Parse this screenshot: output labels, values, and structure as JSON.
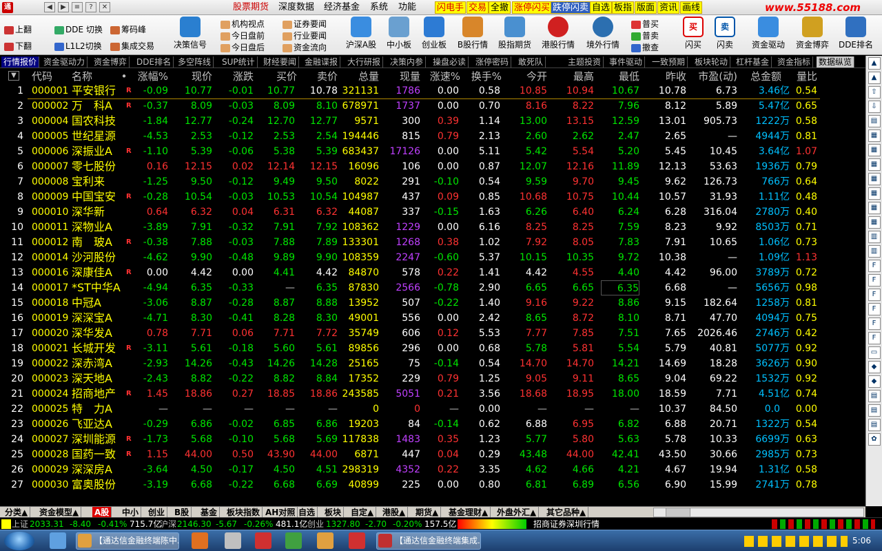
{
  "menubar": {
    "items": [
      "股票期货",
      "深度数据",
      "经济基金",
      "系统",
      "功能"
    ],
    "highlight": [
      "闪电手",
      "交易",
      "全撤",
      "涨停闪买",
      "跌停闪卖",
      "自选",
      "板指",
      "版面",
      "资讯",
      "画线"
    ],
    "url": "www.55188.com"
  },
  "toolbar": {
    "page_up": "上翻",
    "page_down": "下翻",
    "dde_switch": "DDE 切换",
    "l1l2_switch": "L1L2切换",
    "chip_peak": "筹码峰",
    "group_trade": "集成交易",
    "decision_signal": "决策信号",
    "views": [
      "机构视点",
      "今日盘前",
      "今日盘后"
    ],
    "news": [
      "证券要闻",
      "行业要闻",
      "资金流向"
    ],
    "market_buttons": [
      "沪深A股",
      "中小板",
      "创业板",
      "B股行情",
      "股指期货",
      "港股行情",
      "境外行情"
    ],
    "orders": [
      "普买",
      "普卖",
      "撤查"
    ],
    "flash_buy": "闪买",
    "flash_sell": "闪卖",
    "right_buttons": [
      "资金驱动",
      "资金博弈",
      "DDE排名"
    ]
  },
  "tabs": [
    "行情报价",
    "资金驱动力",
    "资金博弈",
    "DDE排名",
    "多空阵线",
    "SUP统计",
    "财经要闻",
    "金融谍报",
    "大行研报",
    "决策内参",
    "操盘必读",
    "涨停密码",
    "敢死队",
    "主题投资",
    "事件驱动",
    "一致预期",
    "板块轮动",
    "杠杆基金",
    "资金指标",
    "数据纵览"
  ],
  "columns": [
    "代码",
    "名称",
    "•",
    "涨幅%",
    "现价",
    "涨跌",
    "买价",
    "卖价",
    "总量",
    "现量",
    "涨速%",
    "换手%",
    "今开",
    "最高",
    "最低",
    "昨收",
    "市盈(动)",
    "总金额",
    "量比"
  ],
  "rows": [
    {
      "n": "1",
      "code": "000001",
      "name": "平安银行",
      "r": "R",
      "chg": "-0.09",
      "price": "10.77",
      "diff": "-0.01",
      "bid": "10.77",
      "ask": "10.78",
      "vol": "321131",
      "cur": "1786",
      "spd": "0.00",
      "turn": "0.58",
      "open": "10.85",
      "high": "10.94",
      "low": "10.67",
      "prev": "10.78",
      "pe": "6.73",
      "amt": "3.46",
      "amtu": "亿",
      "ratio": "0.54"
    },
    {
      "n": "2",
      "code": "000002",
      "name": "万　科A",
      "r": "R",
      "chg": "-0.37",
      "price": "8.09",
      "diff": "-0.03",
      "bid": "8.09",
      "ask": "8.10",
      "vol": "678971",
      "cur": "1737",
      "spd": "0.00",
      "turn": "0.70",
      "open": "8.16",
      "high": "8.22",
      "low": "7.96",
      "prev": "8.12",
      "pe": "5.89",
      "amt": "5.47",
      "amtu": "亿",
      "ratio": "0.65"
    },
    {
      "n": "3",
      "code": "000004",
      "name": "国农科技",
      "r": "",
      "chg": "-1.84",
      "price": "12.77",
      "diff": "-0.24",
      "bid": "12.70",
      "ask": "12.77",
      "vol": "9571",
      "cur": "300",
      "spd": "0.39",
      "turn": "1.14",
      "open": "13.00",
      "high": "13.15",
      "low": "12.59",
      "prev": "13.01",
      "pe": "905.73",
      "amt": "1222",
      "amtu": "万",
      "ratio": "0.58"
    },
    {
      "n": "4",
      "code": "000005",
      "name": "世纪星源",
      "r": "",
      "chg": "-4.53",
      "price": "2.53",
      "diff": "-0.12",
      "bid": "2.53",
      "ask": "2.54",
      "vol": "194446",
      "cur": "815",
      "spd": "0.79",
      "turn": "2.13",
      "open": "2.60",
      "high": "2.62",
      "low": "2.47",
      "prev": "2.65",
      "pe": "—",
      "amt": "4944",
      "amtu": "万",
      "ratio": "0.81"
    },
    {
      "n": "5",
      "code": "000006",
      "name": "深振业A",
      "r": "R",
      "chg": "-1.10",
      "price": "5.39",
      "diff": "-0.06",
      "bid": "5.38",
      "ask": "5.39",
      "vol": "683437",
      "cur": "17126",
      "spd": "0.00",
      "turn": "5.11",
      "open": "5.42",
      "high": "5.54",
      "low": "5.20",
      "prev": "5.45",
      "pe": "10.45",
      "amt": "3.64",
      "amtu": "亿",
      "ratio": "1.07"
    },
    {
      "n": "6",
      "code": "000007",
      "name": "零七股份",
      "r": "",
      "chg": "0.16",
      "price": "12.15",
      "diff": "0.02",
      "bid": "12.14",
      "ask": "12.15",
      "vol": "16096",
      "cur": "106",
      "spd": "0.00",
      "turn": "0.87",
      "open": "12.07",
      "high": "12.16",
      "low": "11.89",
      "prev": "12.13",
      "pe": "53.63",
      "amt": "1936",
      "amtu": "万",
      "ratio": "0.79"
    },
    {
      "n": "7",
      "code": "000008",
      "name": "宝利来",
      "r": "",
      "chg": "-1.25",
      "price": "9.50",
      "diff": "-0.12",
      "bid": "9.49",
      "ask": "9.50",
      "vol": "8022",
      "cur": "291",
      "spd": "-0.10",
      "turn": "0.54",
      "open": "9.59",
      "high": "9.70",
      "low": "9.45",
      "prev": "9.62",
      "pe": "126.73",
      "amt": "766",
      "amtu": "万",
      "ratio": "0.64"
    },
    {
      "n": "8",
      "code": "000009",
      "name": "中国宝安",
      "r": "R",
      "chg": "-0.28",
      "price": "10.54",
      "diff": "-0.03",
      "bid": "10.53",
      "ask": "10.54",
      "vol": "104987",
      "cur": "437",
      "spd": "0.09",
      "turn": "0.85",
      "open": "10.68",
      "high": "10.75",
      "low": "10.44",
      "prev": "10.57",
      "pe": "31.93",
      "amt": "1.11",
      "amtu": "亿",
      "ratio": "0.48"
    },
    {
      "n": "9",
      "code": "000010",
      "name": "深华新",
      "r": "",
      "chg": "0.64",
      "price": "6.32",
      "diff": "0.04",
      "bid": "6.31",
      "ask": "6.32",
      "vol": "44087",
      "cur": "337",
      "spd": "-0.15",
      "turn": "1.63",
      "open": "6.26",
      "high": "6.40",
      "low": "6.24",
      "prev": "6.28",
      "pe": "316.04",
      "amt": "2780",
      "amtu": "万",
      "ratio": "0.40"
    },
    {
      "n": "10",
      "code": "000011",
      "name": "深物业A",
      "r": "",
      "chg": "-3.89",
      "price": "7.91",
      "diff": "-0.32",
      "bid": "7.91",
      "ask": "7.92",
      "vol": "108362",
      "cur": "1229",
      "spd": "0.00",
      "turn": "6.16",
      "open": "8.25",
      "high": "8.25",
      "low": "7.59",
      "prev": "8.23",
      "pe": "9.92",
      "amt": "8503",
      "amtu": "万",
      "ratio": "0.71"
    },
    {
      "n": "11",
      "code": "000012",
      "name": "南　玻A",
      "r": "R",
      "chg": "-0.38",
      "price": "7.88",
      "diff": "-0.03",
      "bid": "7.88",
      "ask": "7.89",
      "vol": "133301",
      "cur": "1268",
      "spd": "0.38",
      "turn": "1.02",
      "open": "7.92",
      "high": "8.05",
      "low": "7.83",
      "prev": "7.91",
      "pe": "10.65",
      "amt": "1.06",
      "amtu": "亿",
      "ratio": "0.73"
    },
    {
      "n": "12",
      "code": "000014",
      "name": "沙河股份",
      "r": "",
      "chg": "-4.62",
      "price": "9.90",
      "diff": "-0.48",
      "bid": "9.89",
      "ask": "9.90",
      "vol": "108359",
      "cur": "2247",
      "spd": "-0.60",
      "turn": "5.37",
      "open": "10.15",
      "high": "10.35",
      "low": "9.72",
      "prev": "10.38",
      "pe": "—",
      "amt": "1.09",
      "amtu": "亿",
      "ratio": "1.13"
    },
    {
      "n": "13",
      "code": "000016",
      "name": "深康佳A",
      "r": "R",
      "chg": "0.00",
      "price": "4.42",
      "diff": "0.00",
      "bid": "4.41",
      "ask": "4.42",
      "vol": "84870",
      "cur": "578",
      "spd": "0.22",
      "turn": "1.41",
      "open": "4.42",
      "high": "4.55",
      "low": "4.40",
      "prev": "4.42",
      "pe": "96.00",
      "amt": "3789",
      "amtu": "万",
      "ratio": "0.72"
    },
    {
      "n": "14",
      "code": "000017",
      "name": "*ST中华A",
      "r": "",
      "chg": "-4.94",
      "price": "6.35",
      "diff": "-0.33",
      "bid": "—",
      "ask": "6.35",
      "vol": "87830",
      "cur": "2566",
      "spd": "-0.78",
      "turn": "2.90",
      "open": "6.65",
      "high": "6.65",
      "low": "6.35",
      "prev": "6.68",
      "pe": "—",
      "amt": "5656",
      "amtu": "万",
      "ratio": "0.98"
    },
    {
      "n": "15",
      "code": "000018",
      "name": "中冠A",
      "r": "",
      "chg": "-3.06",
      "price": "8.87",
      "diff": "-0.28",
      "bid": "8.87",
      "ask": "8.88",
      "vol": "13952",
      "cur": "507",
      "spd": "-0.22",
      "turn": "1.40",
      "open": "9.16",
      "high": "9.22",
      "low": "8.86",
      "prev": "9.15",
      "pe": "182.64",
      "amt": "1258",
      "amtu": "万",
      "ratio": "0.81"
    },
    {
      "n": "16",
      "code": "000019",
      "name": "深深宝A",
      "r": "",
      "chg": "-4.71",
      "price": "8.30",
      "diff": "-0.41",
      "bid": "8.28",
      "ask": "8.30",
      "vol": "49001",
      "cur": "556",
      "spd": "0.00",
      "turn": "2.42",
      "open": "8.65",
      "high": "8.72",
      "low": "8.10",
      "prev": "8.71",
      "pe": "47.70",
      "amt": "4094",
      "amtu": "万",
      "ratio": "0.75"
    },
    {
      "n": "17",
      "code": "000020",
      "name": "深华发A",
      "r": "",
      "chg": "0.78",
      "price": "7.71",
      "diff": "0.06",
      "bid": "7.71",
      "ask": "7.72",
      "vol": "35749",
      "cur": "606",
      "spd": "0.12",
      "turn": "5.53",
      "open": "7.77",
      "high": "7.85",
      "low": "7.51",
      "prev": "7.65",
      "pe": "2026.46",
      "amt": "2746",
      "amtu": "万",
      "ratio": "0.42"
    },
    {
      "n": "18",
      "code": "000021",
      "name": "长城开发",
      "r": "R",
      "chg": "-3.11",
      "price": "5.61",
      "diff": "-0.18",
      "bid": "5.60",
      "ask": "5.61",
      "vol": "89856",
      "cur": "296",
      "spd": "0.00",
      "turn": "0.68",
      "open": "5.78",
      "high": "5.81",
      "low": "5.54",
      "prev": "5.79",
      "pe": "40.81",
      "amt": "5077",
      "amtu": "万",
      "ratio": "0.92"
    },
    {
      "n": "19",
      "code": "000022",
      "name": "深赤湾A",
      "r": "",
      "chg": "-2.93",
      "price": "14.26",
      "diff": "-0.43",
      "bid": "14.26",
      "ask": "14.28",
      "vol": "25165",
      "cur": "75",
      "spd": "-0.14",
      "turn": "0.54",
      "open": "14.70",
      "high": "14.70",
      "low": "14.21",
      "prev": "14.69",
      "pe": "18.28",
      "amt": "3626",
      "amtu": "万",
      "ratio": "0.90"
    },
    {
      "n": "20",
      "code": "000023",
      "name": "深天地A",
      "r": "",
      "chg": "-2.43",
      "price": "8.82",
      "diff": "-0.22",
      "bid": "8.82",
      "ask": "8.84",
      "vol": "17352",
      "cur": "229",
      "spd": "0.79",
      "turn": "1.25",
      "open": "9.05",
      "high": "9.11",
      "low": "8.65",
      "prev": "9.04",
      "pe": "69.22",
      "amt": "1532",
      "amtu": "万",
      "ratio": "0.92"
    },
    {
      "n": "21",
      "code": "000024",
      "name": "招商地产",
      "r": "R",
      "chg": "1.45",
      "price": "18.86",
      "diff": "0.27",
      "bid": "18.85",
      "ask": "18.86",
      "vol": "243585",
      "cur": "5051",
      "spd": "0.21",
      "turn": "3.56",
      "open": "18.68",
      "high": "18.95",
      "low": "18.00",
      "prev": "18.59",
      "pe": "7.71",
      "amt": "4.51",
      "amtu": "亿",
      "ratio": "0.74"
    },
    {
      "n": "22",
      "code": "000025",
      "name": "特　力A",
      "r": "",
      "chg": "—",
      "price": "—",
      "diff": "—",
      "bid": "—",
      "ask": "—",
      "vol": "0",
      "cur": "0",
      "spd": "—",
      "turn": "0.00",
      "open": "—",
      "high": "—",
      "low": "—",
      "prev": "10.37",
      "pe": "84.50",
      "amt": "0.0",
      "amtu": "",
      "ratio": "0.00"
    },
    {
      "n": "23",
      "code": "000026",
      "name": "飞亚达A",
      "r": "",
      "chg": "-0.29",
      "price": "6.86",
      "diff": "-0.02",
      "bid": "6.85",
      "ask": "6.86",
      "vol": "19203",
      "cur": "84",
      "spd": "-0.14",
      "turn": "0.62",
      "open": "6.88",
      "high": "6.95",
      "low": "6.82",
      "prev": "6.88",
      "pe": "20.71",
      "amt": "1322",
      "amtu": "万",
      "ratio": "0.54"
    },
    {
      "n": "24",
      "code": "000027",
      "name": "深圳能源",
      "r": "R",
      "chg": "-1.73",
      "price": "5.68",
      "diff": "-0.10",
      "bid": "5.68",
      "ask": "5.69",
      "vol": "117838",
      "cur": "1483",
      "spd": "0.35",
      "turn": "1.23",
      "open": "5.77",
      "high": "5.80",
      "low": "5.63",
      "prev": "5.78",
      "pe": "10.33",
      "amt": "6699",
      "amtu": "万",
      "ratio": "0.63"
    },
    {
      "n": "25",
      "code": "000028",
      "name": "国药一致",
      "r": "R",
      "chg": "1.15",
      "price": "44.00",
      "diff": "0.50",
      "bid": "43.90",
      "ask": "44.00",
      "vol": "6871",
      "cur": "447",
      "spd": "0.04",
      "turn": "0.29",
      "open": "43.48",
      "high": "44.00",
      "low": "42.41",
      "prev": "43.50",
      "pe": "30.66",
      "amt": "2985",
      "amtu": "万",
      "ratio": "0.73"
    },
    {
      "n": "26",
      "code": "000029",
      "name": "深深房A",
      "r": "",
      "chg": "-3.64",
      "price": "4.50",
      "diff": "-0.17",
      "bid": "4.50",
      "ask": "4.51",
      "vol": "298319",
      "cur": "4352",
      "spd": "0.22",
      "turn": "3.35",
      "open": "4.62",
      "high": "4.66",
      "low": "4.21",
      "prev": "4.67",
      "pe": "19.94",
      "amt": "1.31",
      "amtu": "亿",
      "ratio": "0.58"
    },
    {
      "n": "27",
      "code": "000030",
      "name": "富奥股份",
      "r": "",
      "chg": "-3.19",
      "price": "6.68",
      "diff": "-0.22",
      "bid": "6.68",
      "ask": "6.69",
      "vol": "40899",
      "cur": "225",
      "spd": "0.00",
      "turn": "0.80",
      "open": "6.81",
      "high": "6.89",
      "low": "6.56",
      "prev": "6.90",
      "pe": "15.99",
      "amt": "2741",
      "amtu": "万",
      "ratio": "0.78"
    }
  ],
  "bottom_tabs": [
    "分类▲",
    "资金模型▲",
    "A股",
    "中小",
    "创业",
    "B股",
    "基金",
    "板块指数",
    "AH对照",
    "自选",
    "板块",
    "自定▲",
    "港股▲",
    "期货▲",
    "基金理财▲",
    "外盘外汇▲",
    "其它品种▲"
  ],
  "status": {
    "sh_label": "上证",
    "sh_index": "2033.31",
    "sh_chg": "-8.40",
    "sh_pct": "-0.41%",
    "sh_amt": "715.7亿",
    "sz_label": "沪深",
    "sz_index": "2146.30",
    "sz_chg": "-5.67",
    "sz_pct": "-0.26%",
    "sz_amt": "481.1亿",
    "cy_label": "创业",
    "cy_index": "1327.80",
    "cy_chg": "-2.70",
    "cy_pct": "-0.20%",
    "cy_amt": "157.5亿",
    "broker": "招商证券深圳行情"
  },
  "taskbar": {
    "tasks": [
      "【通达信金融终端陈中...",
      "【通达信金融终端集成..."
    ],
    "clock": "5:06"
  },
  "colors": {
    "up": "#ff3232",
    "down": "#00e600",
    "code": "#ffff00",
    "amount": "#00c0ff",
    "volume": "#c040ff"
  }
}
